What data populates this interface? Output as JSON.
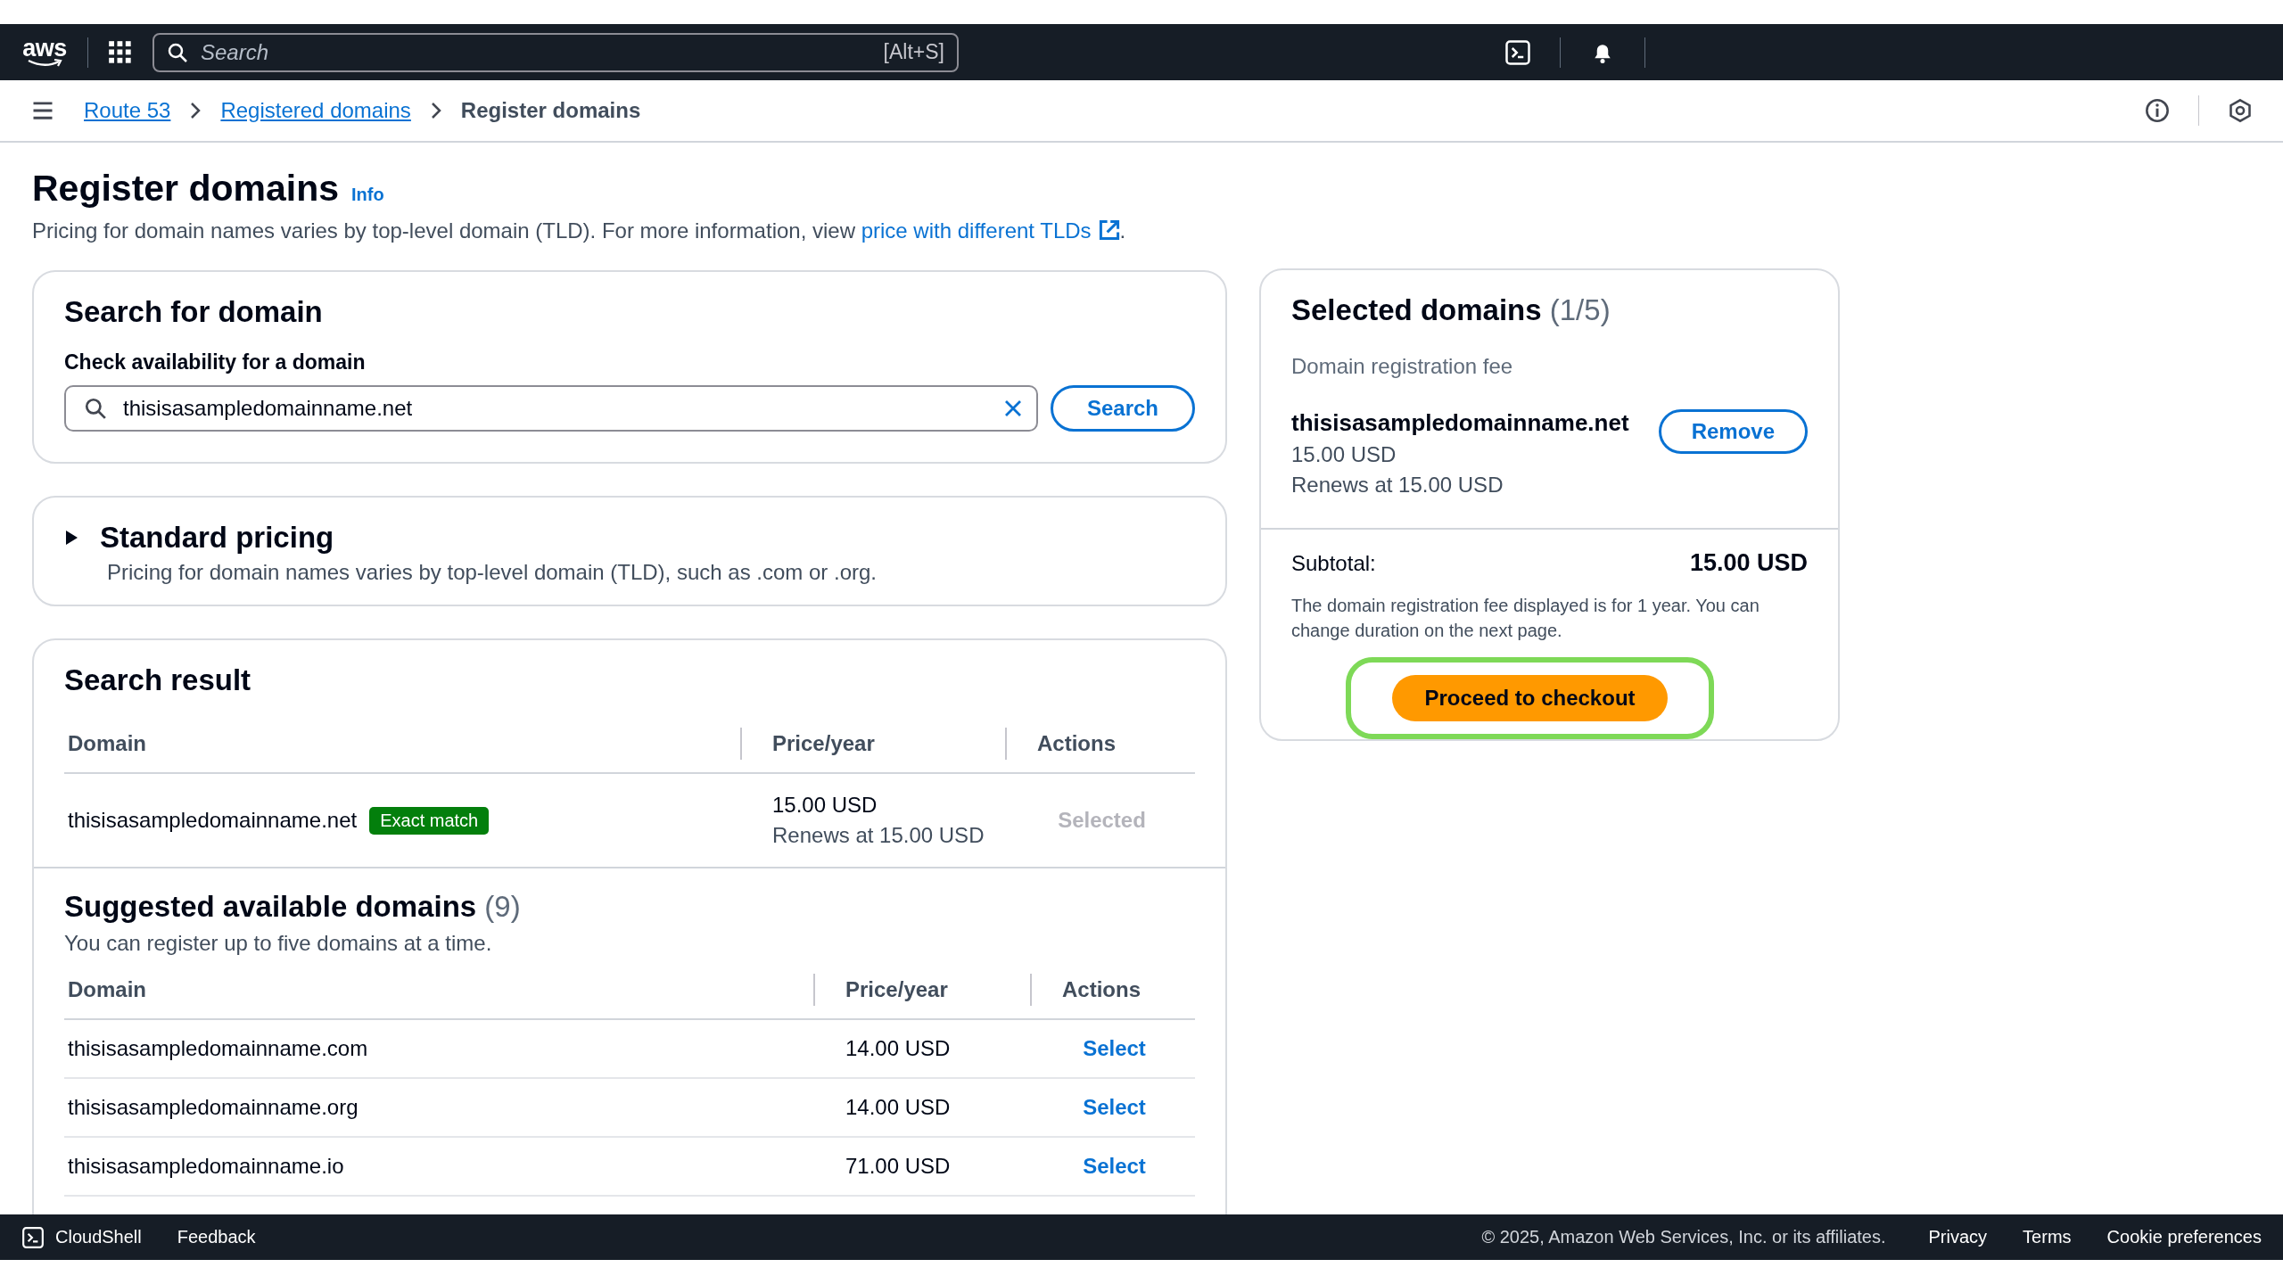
{
  "top_bar": {
    "logo": "aws",
    "search": {
      "placeholder": "Search",
      "shortcut": "[Alt+S]"
    }
  },
  "breadcrumbs": [
    {
      "label": "Route 53",
      "link": true
    },
    {
      "label": "Registered domains",
      "link": true
    },
    {
      "label": "Register domains",
      "link": false
    }
  ],
  "page": {
    "title": "Register domains",
    "info": "Info",
    "description": {
      "text": "Pricing for domain names varies by top-level domain (TLD). For more information, view ",
      "link": "price with different TLDs",
      "end": "."
    }
  },
  "search_card": {
    "title": "Search for domain",
    "label": "Check availability for a domain",
    "value": "thisisasampledomainname.net",
    "button": "Search"
  },
  "standard_pricing": {
    "title": "Standard pricing",
    "expanded": false,
    "description": "Pricing for domain names varies by top-level domain (TLD), such as .com or .org."
  },
  "search_result": {
    "title": "Search result",
    "columns": [
      "Domain",
      "Price/year",
      "Actions"
    ],
    "rows": [
      {
        "domain": "thisisasampledomainname.net",
        "badge": "Exact match",
        "price": "15.00 USD",
        "renewal": "Renews at 15.00 USD",
        "action": "Selected",
        "disabled": true
      }
    ]
  },
  "suggested": {
    "title": "Suggested available domains",
    "count": "(9)",
    "note": "You can register up to five domains at a time.",
    "columns": [
      "Domain",
      "Price/year",
      "Actions"
    ],
    "rows": [
      {
        "domain": "thisisasampledomainname.com",
        "price": "14.00 USD",
        "action": "Select",
        "disabled": false
      },
      {
        "domain": "thisisasampledomainname.org",
        "price": "14.00 USD",
        "action": "Select",
        "disabled": false
      },
      {
        "domain": "thisisasampledomainname.io",
        "price": "71.00 USD",
        "action": "Select",
        "disabled": false
      }
    ]
  },
  "selected_panel": {
    "title": "Selected domains",
    "count": "(1/5)",
    "fee_label": "Domain registration fee",
    "items": [
      {
        "domain": "thisisasampledomainname.net",
        "price": "15.00 USD",
        "renewal": "Renews at 15.00 USD",
        "button": "Remove"
      }
    ],
    "subtotal_label": "Subtotal:",
    "subtotal": "15.00 USD",
    "note": "The domain registration fee displayed is for 1 year. You can change duration on the next page.",
    "checkout": "Proceed to checkout",
    "highlighted": true
  },
  "footer": {
    "cloudshell": "CloudShell",
    "feedback": "Feedback",
    "copyright": "© 2025, Amazon Web Services, Inc. or its affiliates.",
    "links": [
      "Privacy",
      "Terms",
      "Cookie preferences"
    ]
  }
}
